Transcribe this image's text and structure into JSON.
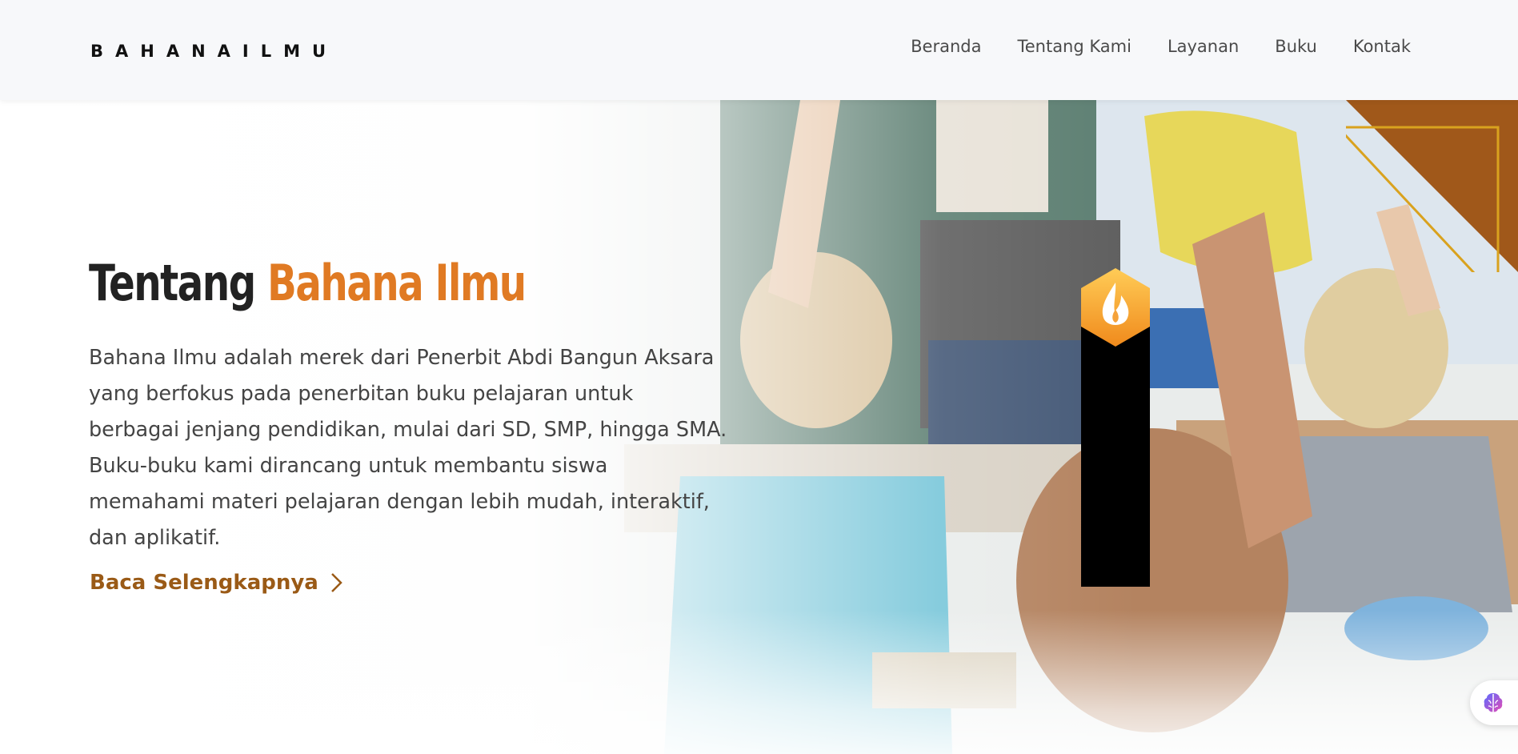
{
  "header": {
    "logo": "BAHANAILMU",
    "nav": [
      "Beranda",
      "Tentang Kami",
      "Layanan",
      "Buku",
      "Kontak"
    ]
  },
  "hero": {
    "title_prefix": "Tentang",
    "title_accent": "Bahana Ilmu",
    "description": "Bahana Ilmu adalah merek dari Penerbit Abdi Bangun Aksara yang berfokus pada penerbitan buku pelajaran untuk berbagai jenjang pendidikan, mulai dari SD, SMP, hingga SMA. Buku-buku kami dirancang untuk membantu siswa memahami materi pelajaran dengan lebih mudah, interaktif, dan aplikatif.",
    "cta_label": "Baca Selengkapnya",
    "cta_icon": "chevron-right-icon"
  },
  "widgets": {
    "flame_icon": "flame-icon",
    "assistant_icon": "brain-icon"
  },
  "colors": {
    "accent": "#e07a23",
    "cta": "#9a5a16",
    "corner": "#a0581a",
    "corner_outline": "#d9a21e",
    "header_bg": "#f7f8fa"
  }
}
